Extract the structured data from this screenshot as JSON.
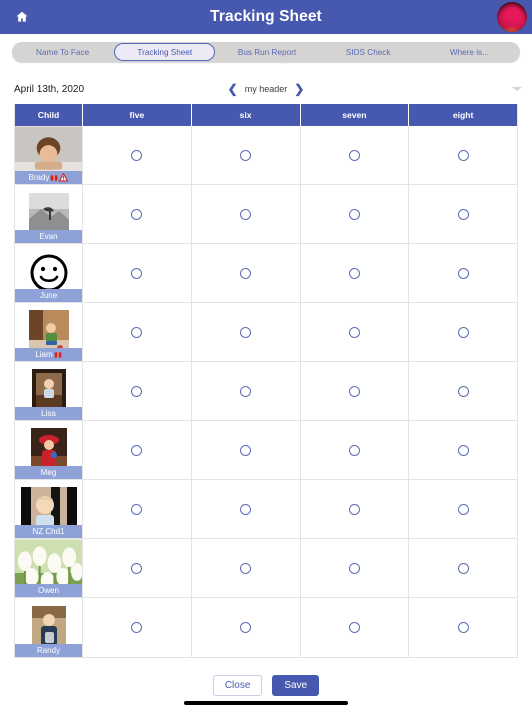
{
  "appbar": {
    "title": "Tracking Sheet",
    "home_icon": "home-icon",
    "avatar_icon": "user-avatar"
  },
  "tabs": [
    {
      "label": "Name To Face",
      "active": false
    },
    {
      "label": "Tracking Sheet",
      "active": true
    },
    {
      "label": "Bus Run Report",
      "active": false
    },
    {
      "label": "SIDS Check",
      "active": false
    },
    {
      "label": "Where is...",
      "active": false
    }
  ],
  "daterow": {
    "date": "April 13th, 2020",
    "prev_icon": "chevron-left-icon",
    "header_text": "my header",
    "next_icon": "chevron-right-icon",
    "caret_icon": "chevron-down-icon"
  },
  "table": {
    "columns": [
      "Child",
      "five",
      "six",
      "seven",
      "eight"
    ],
    "rows": [
      {
        "name": "Brady",
        "photo": "boy-leaning-on-table",
        "badges": [
          "red-book-icon",
          "warning-triangle-icon"
        ]
      },
      {
        "name": "Evan",
        "photo": "grayscale-bird-landscape",
        "badges": []
      },
      {
        "name": "June",
        "photo": "smiley-face-drawing",
        "badges": []
      },
      {
        "name": "Liam",
        "photo": "toddler-playing-with-toys",
        "badges": [
          "red-book-icon"
        ]
      },
      {
        "name": "Lisa",
        "photo": "child-indoors",
        "badges": []
      },
      {
        "name": "Meg",
        "photo": "child-in-red-hat",
        "badges": []
      },
      {
        "name": "NZ Chd1",
        "photo": "baby-in-highchair",
        "badges": []
      },
      {
        "name": "Owen",
        "photo": "white-tulips",
        "badges": []
      },
      {
        "name": "Randy",
        "photo": "boy-holding-cup",
        "badges": []
      }
    ],
    "cell_control": "radio-unselected"
  },
  "footer": {
    "close_label": "Close",
    "save_label": "Save"
  },
  "colors": {
    "brand_blue": "#4759ae",
    "badge_blue": "#8ea2d8",
    "tab_track": "#d6d4d2",
    "radio_border": "#5c6cb5"
  }
}
